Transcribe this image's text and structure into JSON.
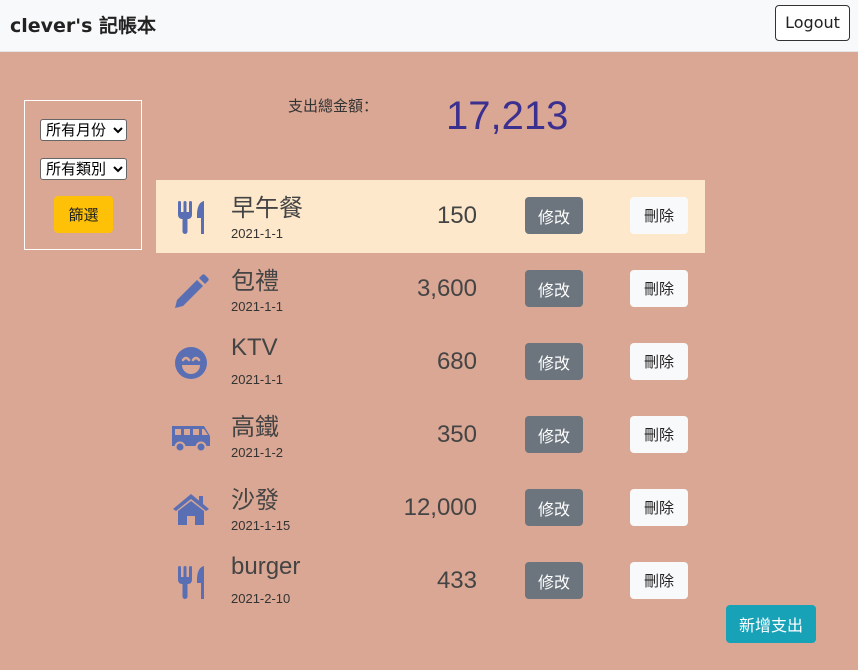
{
  "navbar": {
    "brand": "clever's 記帳本",
    "logout_label": "Logout"
  },
  "filter": {
    "month_selected": "所有月份",
    "category_selected": "所有類別",
    "filter_label": "篩選"
  },
  "summary": {
    "label": "支出總金額：",
    "total": "17,213"
  },
  "records": [
    {
      "icon": "utensils-icon",
      "name": "早午餐",
      "date": "2021-1-1",
      "amount": "150",
      "edit_label": "修改",
      "delete_label": "刪除"
    },
    {
      "icon": "pencil-icon",
      "name": "包禮",
      "date": "2021-1-1",
      "amount": "3,600",
      "edit_label": "修改",
      "delete_label": "刪除"
    },
    {
      "icon": "smile-icon",
      "name": "KTV",
      "date": "2021-1-1",
      "amount": "680",
      "edit_label": "修改",
      "delete_label": "刪除"
    },
    {
      "icon": "bus-icon",
      "name": "高鐵",
      "date": "2021-1-2",
      "amount": "350",
      "edit_label": "修改",
      "delete_label": "刪除"
    },
    {
      "icon": "home-icon",
      "name": "沙發",
      "date": "2021-1-15",
      "amount": "12,000",
      "edit_label": "修改",
      "delete_label": "刪除"
    },
    {
      "icon": "utensils-icon",
      "name": "burger",
      "date": "2021-2-10",
      "amount": "433",
      "edit_label": "修改",
      "delete_label": "刪除"
    }
  ],
  "add_label": "新增支出",
  "colors": {
    "background": "#d9a794",
    "highlight_row": "#fde8cb",
    "icon": "#5a6fb3",
    "total": "#3b2f8f",
    "filter_button": "#ffc107",
    "add_button": "#17a2b8"
  }
}
